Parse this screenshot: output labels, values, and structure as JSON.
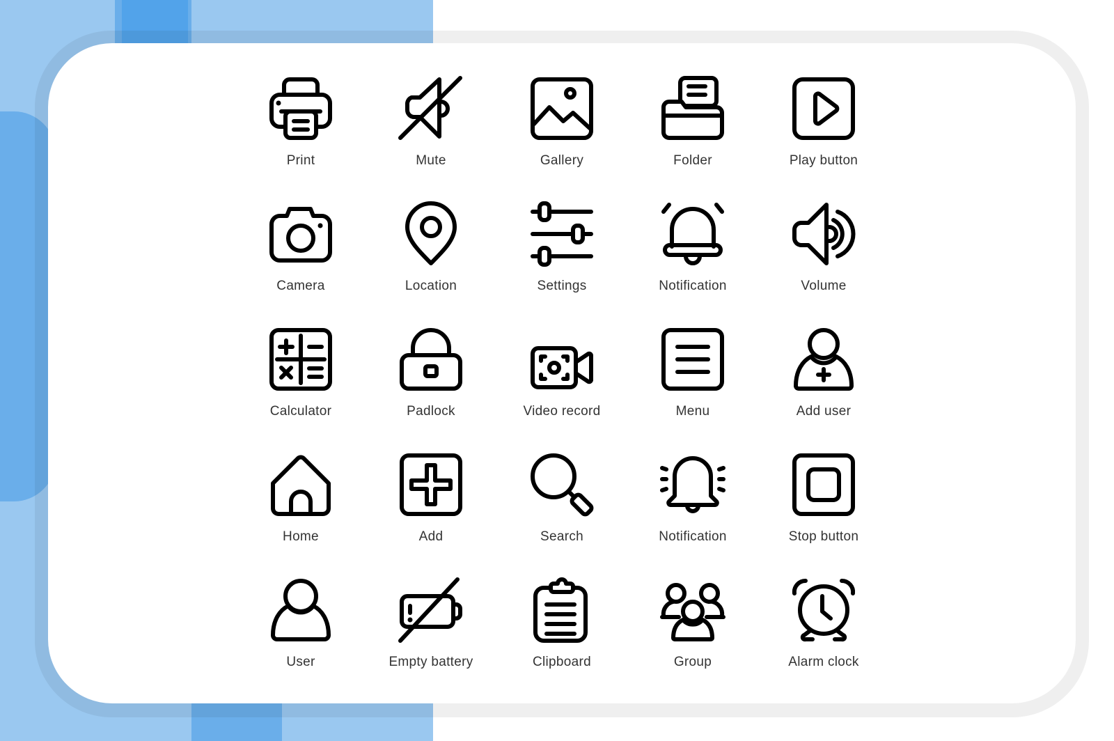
{
  "colors": {
    "panel_light": "#9ac8f0",
    "panel_mid": "#6aaeea",
    "panel_dark": "#52a3ea",
    "frame": "#efefef",
    "card": "#ffffff",
    "icon_stroke": "#000000",
    "label": "#333333"
  },
  "icons": [
    {
      "label": "Print",
      "icon": "printer-icon"
    },
    {
      "label": "Mute",
      "icon": "mute-icon"
    },
    {
      "label": "Gallery",
      "icon": "gallery-icon"
    },
    {
      "label": "Folder",
      "icon": "folder-icon"
    },
    {
      "label": "Play button",
      "icon": "play-button-icon"
    },
    {
      "label": "Camera",
      "icon": "camera-icon"
    },
    {
      "label": "Location",
      "icon": "location-icon"
    },
    {
      "label": "Settings",
      "icon": "settings-sliders-icon"
    },
    {
      "label": "Notification",
      "icon": "alarm-bell-icon"
    },
    {
      "label": "Volume",
      "icon": "volume-icon"
    },
    {
      "label": "Calculator",
      "icon": "calculator-icon"
    },
    {
      "label": "Padlock",
      "icon": "padlock-icon"
    },
    {
      "label": "Video record",
      "icon": "video-record-icon"
    },
    {
      "label": "Menu",
      "icon": "menu-icon"
    },
    {
      "label": "Add user",
      "icon": "add-user-icon"
    },
    {
      "label": "Home",
      "icon": "home-icon"
    },
    {
      "label": "Add",
      "icon": "add-icon"
    },
    {
      "label": "Search",
      "icon": "search-icon"
    },
    {
      "label": "Notification",
      "icon": "ringing-bell-icon"
    },
    {
      "label": "Stop button",
      "icon": "stop-button-icon"
    },
    {
      "label": "User",
      "icon": "user-icon"
    },
    {
      "label": "Empty battery",
      "icon": "empty-battery-icon"
    },
    {
      "label": "Clipboard",
      "icon": "clipboard-icon"
    },
    {
      "label": "Group",
      "icon": "group-icon"
    },
    {
      "label": "Alarm clock",
      "icon": "alarm-clock-icon"
    }
  ]
}
